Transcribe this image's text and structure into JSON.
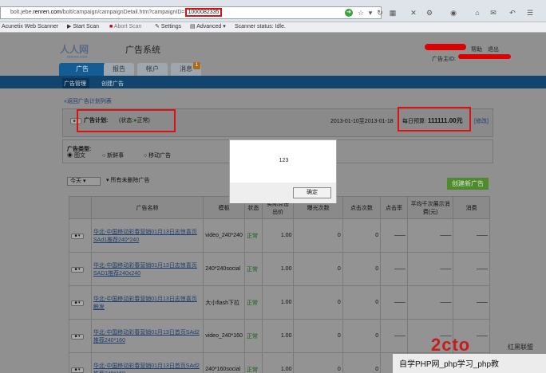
{
  "browser": {
    "url_prefix": "bolt.jebe.",
    "url_host": "renren.com",
    "url_path": "/bolt/campaign/campaignDetail.htm?campaignID=",
    "url_campaign_id": "1000082335"
  },
  "scanner_bar": {
    "app": "Acunetix Web Scanner",
    "start_scan": "Start Scan",
    "abort_scan": "Abort Scan",
    "settings": "Settings",
    "advanced": "Advanced",
    "status": "Scanner status: Idle."
  },
  "site": {
    "logo": "人人网",
    "logo_sub": "renren.com",
    "system_name": "广告系统",
    "help": "帮助",
    "logout": "退出",
    "owner_label": "广告主ID:"
  },
  "tabs": [
    {
      "label": "广告"
    },
    {
      "label": "报告"
    },
    {
      "label": "帐户"
    },
    {
      "label": "消息"
    }
  ],
  "tab_badge": "1",
  "subnav": {
    "manage": "广告管理",
    "create": "创建广告"
  },
  "back_link": "«返回广告计划列表",
  "plan": {
    "toggle": "■ ▾",
    "label": "广告计划:",
    "status_prefix": "(状态:",
    "status_value": "正常)",
    "dates": "2013-01-10至2013-01-18",
    "budget_label": "每日预算:",
    "budget_value": "111111.00元",
    "modify": "[修改]"
  },
  "ad_type": {
    "title": "广告类型:",
    "options": [
      "◉ 图文",
      "○ 新鲜事",
      "○ 移动广告"
    ]
  },
  "filters": {
    "range": "今天",
    "all_ads": "所有未删除广告",
    "create_new": "创建新广告"
  },
  "table": {
    "headers": [
      "",
      "广告名称",
      "模板",
      "状态",
      "实际点击出价",
      "曝光次数",
      "点击次数",
      "点击率",
      "平均千次展示消费(元)",
      "消费"
    ],
    "rows": [
      {
        "name": "华北-中国移动彩春营销01月13日志惊喜页SAd1推荐240*240",
        "template": "video_240*240",
        "status": "正常",
        "bid": "1.00",
        "impressions": "0",
        "clicks": "0",
        "ctr": "——",
        "cpm": "——",
        "cost": "——"
      },
      {
        "name": "华北-中国移动彩春营销01月13日志惊喜页SAD1推荐240x240",
        "template": "240*240social",
        "status": "正常",
        "bid": "1.00",
        "impressions": "0",
        "clicks": "0",
        "ctr": "——",
        "cpm": "——",
        "cost": "——"
      },
      {
        "name": "华北-中国移动彩春营销01月13日志惊喜页触发",
        "template": "大小flash下拉",
        "status": "正常",
        "bid": "1.00",
        "impressions": "0",
        "clicks": "0",
        "ctr": "——",
        "cpm": "——",
        "cost": "——"
      },
      {
        "name": "华北-中国移动彩春营销01月13日首页SAd2推荐240*160",
        "template": "video_240*160",
        "status": "正常",
        "bid": "1.00",
        "impressions": "0",
        "clicks": "0",
        "ctr": "——",
        "cpm": "——",
        "cost": "——"
      },
      {
        "name": "华北-中国移动彩春营销01月13日首页SAd2推荐240*160",
        "template": "240*160social",
        "status": "正常",
        "bid": "1.00",
        "impressions": "0",
        "clicks": "0",
        "ctr": "——",
        "cpm": "——",
        "cost": "——"
      }
    ]
  },
  "dialog": {
    "message": "123",
    "ok": "确定"
  },
  "watermark": {
    "text": "自学PHP网_php学习_php教",
    "logo": "2cto",
    "logo2": "红黑联盟"
  }
}
